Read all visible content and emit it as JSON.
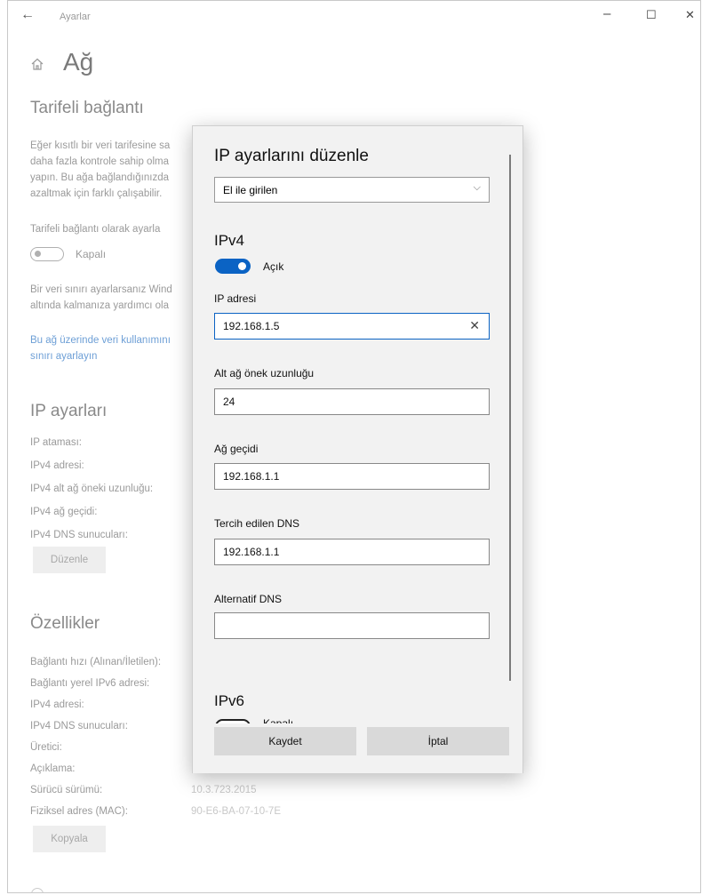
{
  "window": {
    "title": "Ayarlar",
    "controls": {
      "minimize": "–",
      "maximize": "☐",
      "close": "✕"
    },
    "back_glyph": "←"
  },
  "page": {
    "title": "Ağ",
    "metered": {
      "heading": "Tarifeli bağlantı",
      "desc_lines": [
        "Eğer kısıtlı bir veri tarifesine sa",
        "daha fazla kontrole sahip olma",
        "yapın. Bu ağa bağlandığınızda",
        "azaltmak için farklı çalışabilir."
      ],
      "toggle_label": "Tarifeli bağlantı olarak ayarla",
      "toggle_state": "Kapalı",
      "limit_lines": [
        "Bir veri sınırı ayarlarsanız Wind",
        "altında kalmanıza yardımcı ola"
      ],
      "link_lines": [
        "Bu ağ üzerinde veri kullanımını",
        "sınırı ayarlayın"
      ]
    },
    "ip_settings": {
      "heading": "IP ayarları",
      "rows": [
        "IP ataması:",
        "IPv4 adresi:",
        "IPv4 alt ağ öneki uzunluğu:",
        "IPv4 ağ geçidi:",
        "IPv4 DNS sunucuları:"
      ],
      "edit_button": "Düzenle"
    },
    "properties": {
      "heading": "Özellikler",
      "rows": [
        "Bağlantı hızı (Alınan/İletilen):",
        "Bağlantı yerel IPv6 adresi:",
        "IPv4 adresi:",
        "IPv4 DNS sunucuları:",
        "Üretici:",
        "Açıklama:",
        "Sürücü sürümü:",
        "Fiziksel adres (MAC):"
      ],
      "driver_version": "10.3.723.2015",
      "mac": "90-E6-BA-07-10-7E",
      "copy_button": "Kopyala"
    }
  },
  "dialog": {
    "title": "IP ayarlarını düzenle",
    "mode_select": "El ile girilen",
    "ipv4": {
      "heading": "IPv4",
      "toggle_state": "Açık",
      "ip_label": "IP adresi",
      "ip_value": "192.168.1.5",
      "prefix_label": "Alt ağ önek uzunluğu",
      "prefix_value": "24",
      "gateway_label": "Ağ geçidi",
      "gateway_value": "192.168.1.1",
      "dns_label": "Tercih edilen DNS",
      "dns_value": "192.168.1.1",
      "alt_dns_label": "Alternatif DNS",
      "alt_dns_value": ""
    },
    "ipv6": {
      "heading": "IPv6",
      "toggle_state": "Kapalı"
    },
    "save_button": "Kaydet",
    "cancel_button": "İptal"
  }
}
